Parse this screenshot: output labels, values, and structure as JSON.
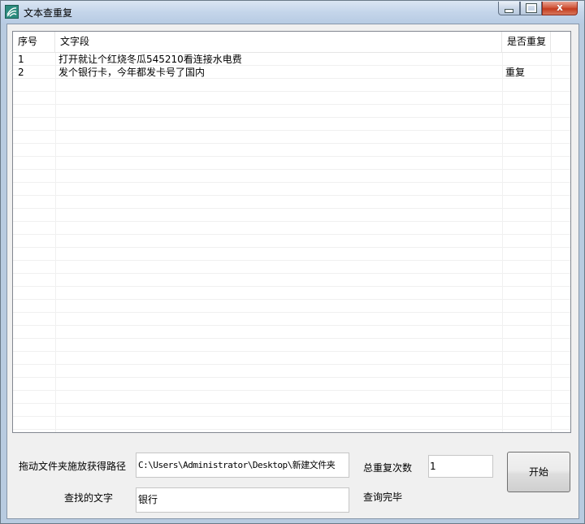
{
  "window": {
    "title": "文本查重复",
    "close_glyph": "x"
  },
  "list": {
    "columns": [
      "序号",
      "文字段",
      "是否重复"
    ],
    "rows": [
      {
        "no": "1",
        "text": "打开就让个红烧冬瓜545210看连接水电费",
        "dup": ""
      },
      {
        "no": "2",
        "text": "发个银行卡，今年都发卡号了国内",
        "dup": "重复"
      }
    ]
  },
  "form": {
    "path_label": "拖动文件夹施放获得路径",
    "path_value": "C:\\Users\\Administrator\\Desktop\\新建文件夹",
    "search_label": "查找的文字",
    "search_value": "银行",
    "total_label": "总重复次数",
    "total_value": "1",
    "status_text": "查询完毕",
    "start_label": "开始"
  }
}
